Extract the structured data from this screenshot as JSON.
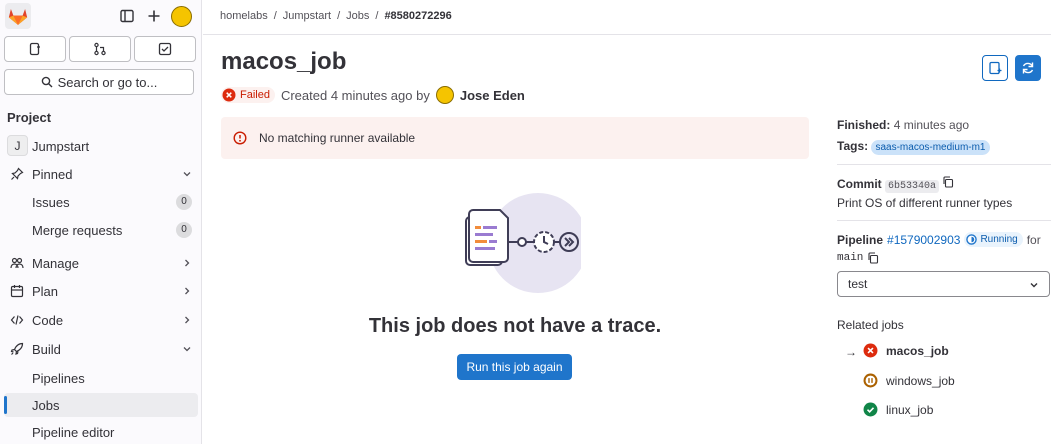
{
  "sidebar": {
    "search_label": "Search or go to...",
    "section_title": "Project",
    "project_initial": "J",
    "project_name": "Jumpstart",
    "items": [
      {
        "label": "Pinned"
      },
      {
        "label": "Issues",
        "count": "0"
      },
      {
        "label": "Merge requests",
        "count": "0"
      },
      {
        "label": "Manage"
      },
      {
        "label": "Plan"
      },
      {
        "label": "Code"
      },
      {
        "label": "Build"
      },
      {
        "label": "Pipelines"
      },
      {
        "label": "Jobs"
      },
      {
        "label": "Pipeline editor"
      }
    ]
  },
  "breadcrumb": [
    "homelabs",
    "Jumpstart",
    "Jobs",
    "#8580272296"
  ],
  "job": {
    "title": "macos_job",
    "status": "Failed",
    "created_text": "Created 4 minutes ago by",
    "author": "Jose Eden"
  },
  "alert": {
    "text": "No matching runner available"
  },
  "empty_state": {
    "title": "This job does not have a trace.",
    "button": "Run this job again"
  },
  "details": {
    "finished_label": "Finished:",
    "finished_value": "4 minutes ago",
    "tags_label": "Tags:",
    "tag": "saas-macos-medium-m1",
    "commit_label": "Commit",
    "commit_sha": "6b53340a",
    "commit_message": "Print OS of different runner types",
    "pipeline_label": "Pipeline",
    "pipeline_id": "#1579002903",
    "pipeline_status": "Running",
    "pipeline_for": "for",
    "branch": "main",
    "stage": "test",
    "related_label": "Related jobs",
    "related_jobs": [
      {
        "name": "macos_job",
        "status": "failed"
      },
      {
        "name": "windows_job",
        "status": "pending"
      },
      {
        "name": "linux_job",
        "status": "success"
      }
    ]
  },
  "colors": {
    "accent": "#1f75cb",
    "failed": "#dd2b0e",
    "success": "#108548",
    "pending": "#ab6100"
  }
}
